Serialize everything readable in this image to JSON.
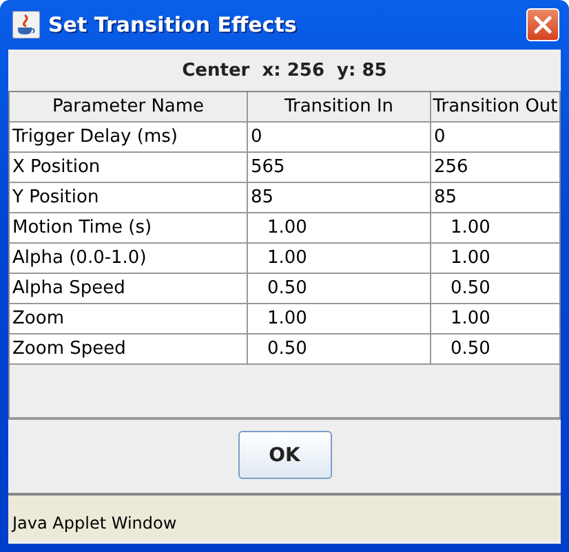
{
  "window": {
    "title": "Set Transition Effects"
  },
  "center_label": "Center  x: 256  y: 85",
  "table": {
    "columns": [
      "Parameter Name",
      "Transition In",
      "Transition Out"
    ],
    "rows": [
      {
        "kind": "integer",
        "name": "Trigger Delay (ms)",
        "in": "0",
        "out": "0"
      },
      {
        "kind": "integer",
        "name": "X Position",
        "in": "565",
        "out": "256"
      },
      {
        "kind": "integer",
        "name": "Y Position",
        "in": "85",
        "out": "85"
      },
      {
        "kind": "decimal",
        "name": "Motion Time (s)",
        "in": "1.00",
        "out": "1.00"
      },
      {
        "kind": "decimal",
        "name": "Alpha (0.0-1.0)",
        "in": "1.00",
        "out": "1.00"
      },
      {
        "kind": "decimal",
        "name": "Alpha Speed",
        "in": "0.50",
        "out": "0.50"
      },
      {
        "kind": "decimal",
        "name": "Zoom",
        "in": "1.00",
        "out": "1.00"
      },
      {
        "kind": "decimal",
        "name": "Zoom Speed",
        "in": "0.50",
        "out": "0.50"
      }
    ]
  },
  "buttons": [
    "OK"
  ],
  "status_bar": "Java Applet Window"
}
